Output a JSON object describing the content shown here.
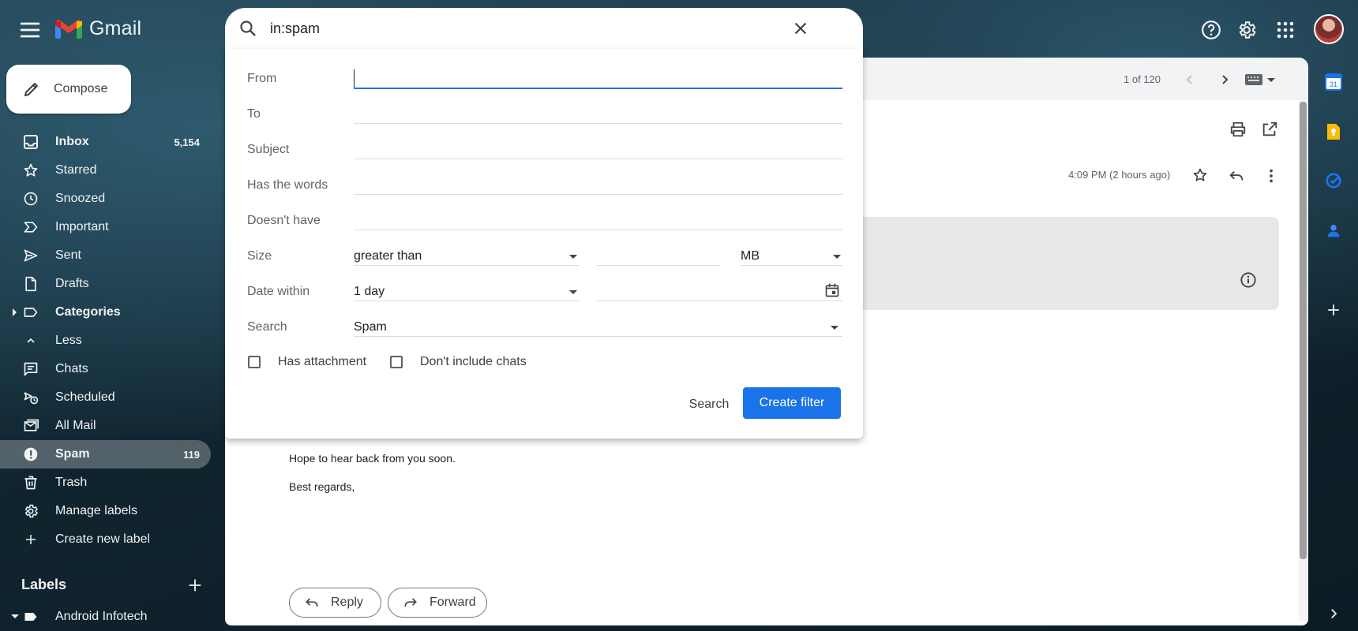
{
  "header": {
    "app_name": "Gmail",
    "icons": [
      "menu-icon",
      "help-icon",
      "settings-icon",
      "apps-icon",
      "avatar"
    ]
  },
  "compose": {
    "label": "Compose"
  },
  "sidebar": {
    "items": [
      {
        "label": "Inbox",
        "count": "5,154",
        "icon": "inbox-icon",
        "bold": true
      },
      {
        "label": "Starred",
        "count": "",
        "icon": "star-icon"
      },
      {
        "label": "Snoozed",
        "count": "",
        "icon": "clock-icon"
      },
      {
        "label": "Important",
        "count": "",
        "icon": "important-icon"
      },
      {
        "label": "Sent",
        "count": "",
        "icon": "send-icon"
      },
      {
        "label": "Drafts",
        "count": "",
        "icon": "draft-icon"
      },
      {
        "label": "Categories",
        "count": "",
        "icon": "label-icon",
        "bold": true
      },
      {
        "label": "Less",
        "count": "",
        "icon": "chevron-up-icon"
      },
      {
        "label": "Chats",
        "count": "",
        "icon": "chat-icon"
      },
      {
        "label": "Scheduled",
        "count": "",
        "icon": "scheduled-icon"
      },
      {
        "label": "All Mail",
        "count": "",
        "icon": "all-mail-icon"
      },
      {
        "label": "Spam",
        "count": "119",
        "icon": "spam-icon",
        "bold": true,
        "active": true
      },
      {
        "label": "Trash",
        "count": "",
        "icon": "trash-icon"
      },
      {
        "label": "Manage labels",
        "count": "",
        "icon": "gear-icon"
      },
      {
        "label": "Create new label",
        "count": "",
        "icon": "plus-icon"
      }
    ],
    "labels_title": "Labels",
    "user_labels": [
      {
        "label": "Android Infotech"
      }
    ]
  },
  "search": {
    "query": "in:spam",
    "fields": {
      "from_label": "From",
      "to_label": "To",
      "subject_label": "Subject",
      "has_words_label": "Has the words",
      "doesnt_have_label": "Doesn't have",
      "size_label": "Size",
      "size_operator": "greater than",
      "size_unit": "MB",
      "date_within_label": "Date within",
      "date_within_value": "1 day",
      "search_in_label": "Search",
      "search_in_value": "Spam",
      "has_attachment_label": "Has attachment",
      "dont_include_chats_label": "Don't include chats"
    },
    "search_button": "Search",
    "create_filter_button": "Create filter"
  },
  "message": {
    "page_count": "1 of 120",
    "time": "4:09 PM (2 hours ago)",
    "body_lines": [
      "Hope to hear back from you soon.",
      "Best regards,"
    ],
    "reply_label": "Reply",
    "forward_label": "Forward"
  },
  "colors": {
    "accent": "#1a73e8",
    "gmail_red": "#ea4335",
    "calendar_blue": "#1a73e8",
    "keep_yellow": "#fbbc04"
  }
}
